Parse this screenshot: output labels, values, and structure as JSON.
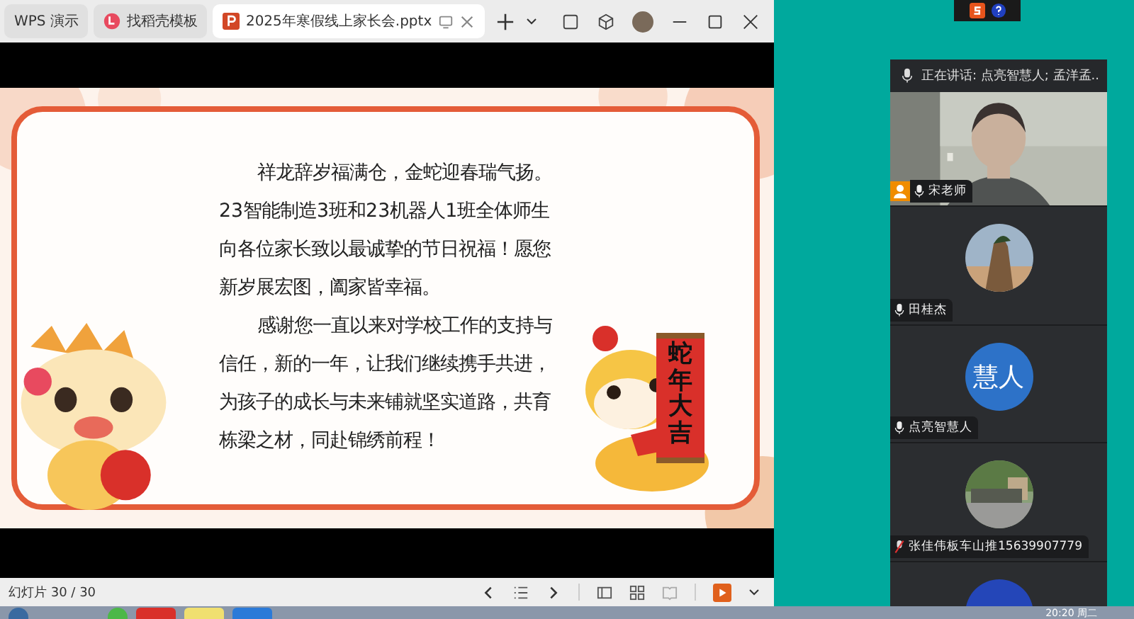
{
  "tabs": [
    {
      "label": "WPS 演示",
      "kind": "home",
      "selected": false
    },
    {
      "label": "找稻壳模板",
      "kind": "template",
      "selected": false
    },
    {
      "label": "2025年寒假线上家长会.pptx",
      "kind": "file",
      "selected": true
    }
  ],
  "slide": {
    "paragraphs": [
      "祥龙辞岁福满仓，金蛇迎春瑞气扬。23智能制造3班和23机器人1班全体师生向各位家长致以最诚挚的节日祝福！愿您新岁展宏图，阖家皆幸福。",
      "感谢您一直以来对学校工作的支持与信任，新的一年，让我们继续携手共进，为孩子的成长与未来铺就坚实道路，共育栋梁之材，同赴锦绣前程！"
    ],
    "scroll_text": "蛇年大吉"
  },
  "status_bar": {
    "slide_counter": "幻灯片 30 / 30"
  },
  "meeting": {
    "speaking": "正在讲话:  点亮智慧人; 孟洋孟..",
    "participants": [
      {
        "name": "宋老师",
        "kind": "video",
        "muted": false,
        "host": true
      },
      {
        "name": "田桂杰",
        "muted": false,
        "host": false
      },
      {
        "name": "点亮智慧人",
        "kind": "initials",
        "initials": "慧人",
        "muted": false,
        "host": false
      },
      {
        "name": "张佳伟板车山推15639907779",
        "muted": true,
        "host": false
      }
    ]
  },
  "clock": "20:20 周二"
}
